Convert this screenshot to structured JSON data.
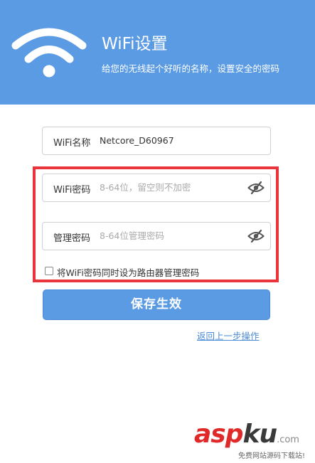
{
  "header": {
    "title": "WiFi设置",
    "subtitle": "给您的无线起个好听的名称，设置安全的密码"
  },
  "form": {
    "ssid": {
      "label": "WiFi名称",
      "value": "Netcore_D60967"
    },
    "wifi_password": {
      "label": "WiFi密码",
      "placeholder": "8-64位，留空则不加密"
    },
    "admin_password": {
      "label": "管理密码",
      "placeholder": "8-64位管理密码"
    },
    "same_password_checkbox": {
      "label": "将WiFi密码同时设为路由器管理密码",
      "checked": false
    }
  },
  "actions": {
    "save_label": "保存生效",
    "back_label": "返回上一步操作"
  },
  "watermark": {
    "logo_part1": "asp",
    "logo_part2": "ku",
    "logo_suffix": ".com",
    "tagline": "免费网站源码下载站!"
  },
  "colors": {
    "header_bg": "#5b9be3",
    "button_bg": "#5b9be3",
    "highlight_border": "#e8343a",
    "link": "#4a8ad6"
  },
  "icons": {
    "header": "wifi-icon",
    "password_toggle": "eye-slash-icon"
  }
}
